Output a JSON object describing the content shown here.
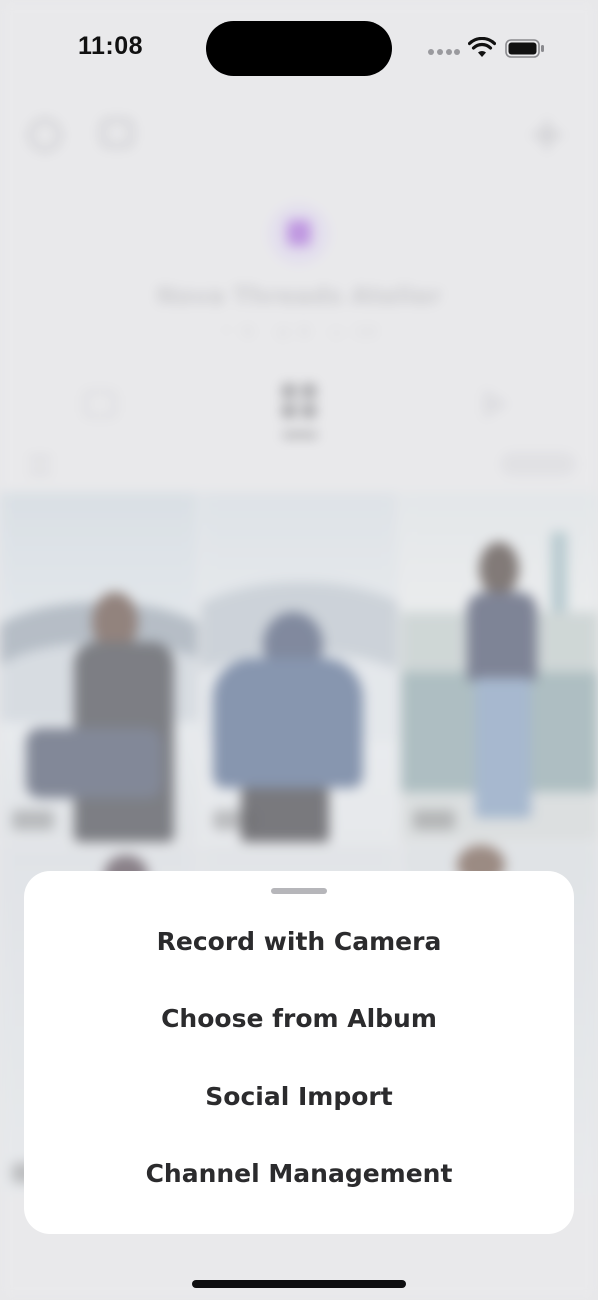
{
  "status_bar": {
    "time": "11:08",
    "icons": [
      "cellular-dots-icon",
      "wifi-icon",
      "battery-icon"
    ]
  },
  "profile": {
    "name": "Nova Threads Atelier",
    "stats": "♡ 6 · ◎ 6 · ▷ 10"
  },
  "tabs": [
    {
      "icon": "folder-icon"
    },
    {
      "icon": "grid-icon",
      "selected": true
    },
    {
      "icon": "play-icon"
    }
  ],
  "filter": {
    "label": "All"
  },
  "action_sheet": {
    "items": [
      {
        "label": "Record with Camera"
      },
      {
        "label": "Choose from Album"
      },
      {
        "label": "Social Import"
      },
      {
        "label": "Channel Management"
      }
    ]
  },
  "colors": {
    "sheet_bg": "#ffffff",
    "sheet_text": "#2b2b2d",
    "avatar_accent": "#9b52d6",
    "backdrop": "#e4e4e6"
  }
}
